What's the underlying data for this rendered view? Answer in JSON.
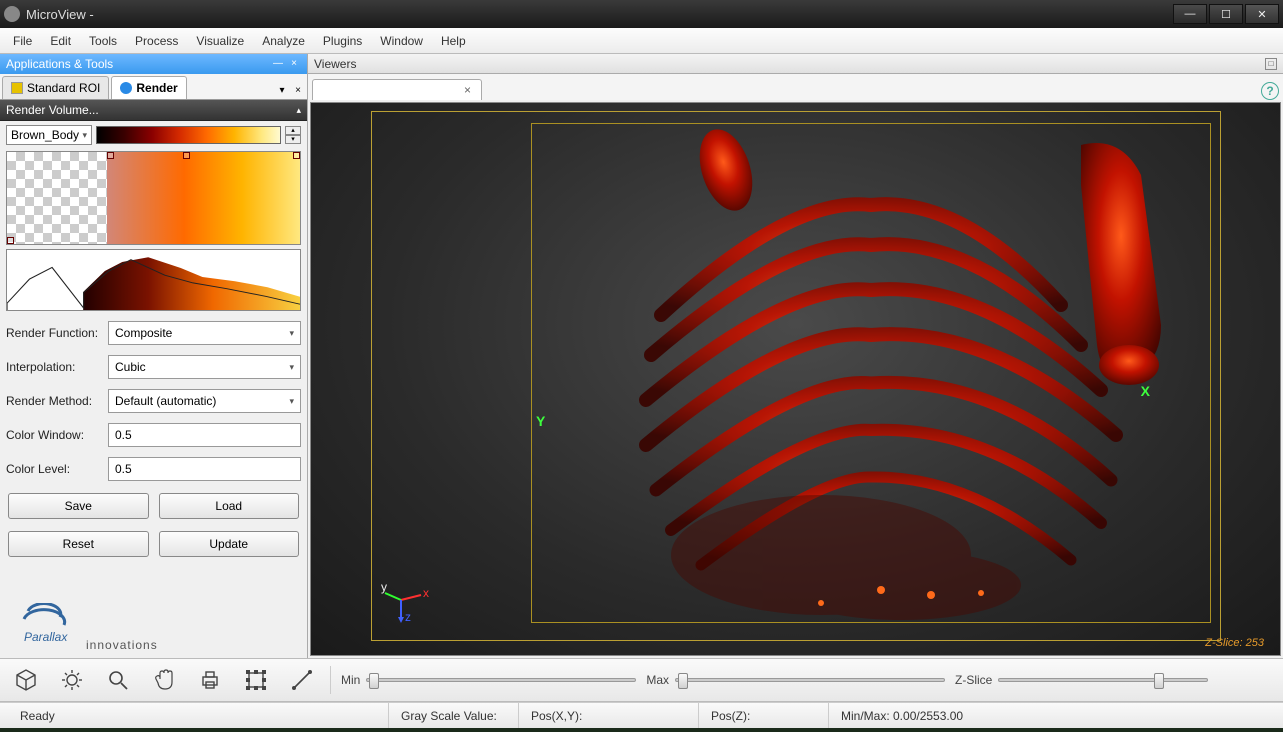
{
  "window": {
    "title": "MicroView -"
  },
  "menu": {
    "items": [
      "File",
      "Edit",
      "Tools",
      "Process",
      "Visualize",
      "Analyze",
      "Plugins",
      "Window",
      "Help"
    ]
  },
  "left": {
    "header": "Applications & Tools",
    "tabs": {
      "roi": "Standard ROI",
      "render": "Render"
    },
    "section_title": "Render Volume...",
    "lut": "Brown_Body",
    "labels": {
      "render_function": "Render Function:",
      "interpolation": "Interpolation:",
      "render_method": "Render Method:",
      "color_window": "Color Window:",
      "color_level": "Color Level:"
    },
    "values": {
      "render_function": "Composite",
      "interpolation": "Cubic",
      "render_method": "Default (automatic)",
      "color_window": "0.5",
      "color_level": "0.5"
    },
    "buttons": {
      "save": "Save",
      "load": "Load",
      "reset": "Reset",
      "update": "Update"
    },
    "logo": {
      "name": "Parallax",
      "sub": "innovations"
    }
  },
  "viewer": {
    "header": "Viewers",
    "tab_label": "",
    "axis_x": "X",
    "axis_y": "Y",
    "z_slice_text": "Z-Slice: 253"
  },
  "toolbar": {
    "min": "Min",
    "max": "Max",
    "z_slice": "Z-Slice"
  },
  "status": {
    "ready": "Ready",
    "gray": "Gray Scale Value:",
    "posxy": "Pos(X,Y):",
    "posz": "Pos(Z):",
    "minmax": "Min/Max: 0.00/2553.00"
  }
}
